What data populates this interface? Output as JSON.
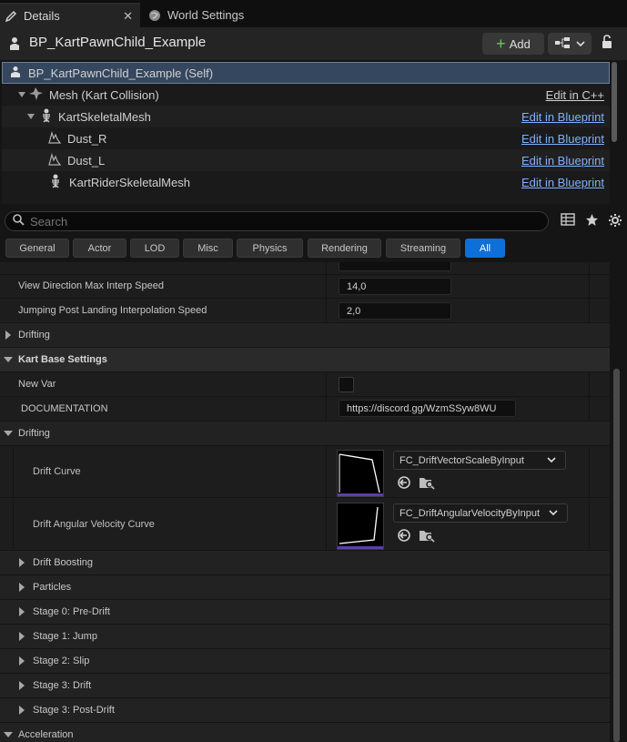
{
  "tabs": [
    {
      "label": "Details",
      "icon": "pencil-icon"
    },
    {
      "label": "World Settings",
      "icon": "globe-icon"
    }
  ],
  "header": {
    "title": "BP_KartPawnChild_Example",
    "add_label": "Add"
  },
  "tree": [
    {
      "label": "BP_KartPawnChild_Example (Self)",
      "link": ""
    },
    {
      "label": "Mesh (Kart Collision)",
      "link": "Edit in C++"
    },
    {
      "label": "KartSkeletalMesh",
      "link": "Edit in Blueprint"
    },
    {
      "label": "Dust_R",
      "link": "Edit in Blueprint"
    },
    {
      "label": "Dust_L",
      "link": "Edit in Blueprint"
    },
    {
      "label": "KartRiderSkeletalMesh",
      "link": "Edit in Blueprint"
    }
  ],
  "search": {
    "placeholder": "Search"
  },
  "filters": [
    "General",
    "Actor",
    "LOD",
    "Misc",
    "Physics",
    "Rendering",
    "Streaming",
    "All"
  ],
  "props": {
    "view_dir_label": "View Direction Max Interp Speed",
    "view_dir_value": "14,0",
    "jump_label": "Jumping Post Landing Interpolation Speed",
    "jump_value": "2,0",
    "drifting1": "Drifting",
    "kart_base": "Kart Base Settings",
    "new_var": "New Var",
    "doc_label": "DOCUMENTATION",
    "doc_value": "https://discord.gg/WzmSSyw8WU",
    "drifting2": "Drifting",
    "drift_curve_label": "Drift Curve",
    "drift_curve_value": "FC_DriftVectorScaleByInput",
    "drift_ang_label": "Drift Angular Velocity Curve",
    "drift_ang_value": "FC_DriftAngularVelocityByInput",
    "drift_boosting": "Drift Boosting",
    "particles": "Particles",
    "stage0": "Stage 0: Pre-Drift",
    "stage1": "Stage 1: Jump",
    "stage2": "Stage 2: Slip",
    "stage3": "Stage 3: Drift",
    "stage3post": "Stage 3: Post-Drift",
    "acceleration": "Acceleration"
  }
}
